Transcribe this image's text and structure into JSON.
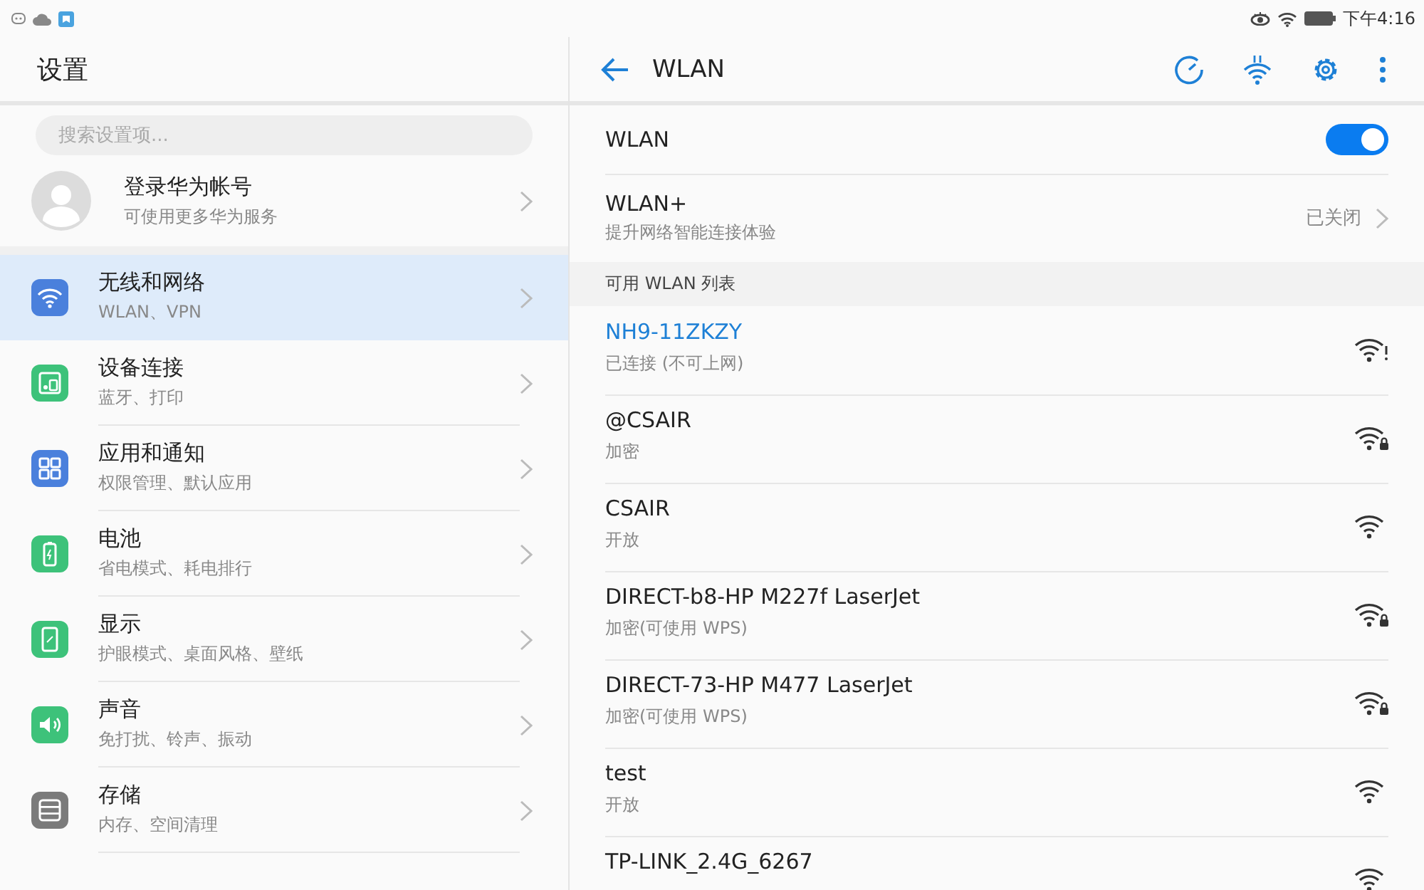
{
  "status_bar": {
    "time": "下午4:16"
  },
  "sidebar": {
    "title": "设置",
    "search": {
      "placeholder": "搜索设置项..."
    },
    "account": {
      "title": "登录华为帐号",
      "subtitle": "可使用更多华为服务"
    },
    "items": [
      {
        "title": "无线和网络",
        "subtitle": "WLAN、VPN",
        "color": "#4a80dc",
        "selected": true
      },
      {
        "title": "设备连接",
        "subtitle": "蓝牙、打印",
        "color": "#3dc27a",
        "selected": false
      },
      {
        "title": "应用和通知",
        "subtitle": "权限管理、默认应用",
        "color": "#4a80dc",
        "selected": false
      },
      {
        "title": "电池",
        "subtitle": "省电模式、耗电排行",
        "color": "#3dc27a",
        "selected": false
      },
      {
        "title": "显示",
        "subtitle": "护眼模式、桌面风格、壁纸",
        "color": "#3dc27a",
        "selected": false
      },
      {
        "title": "声音",
        "subtitle": "免打扰、铃声、振动",
        "color": "#3dc27a",
        "selected": false
      },
      {
        "title": "存储",
        "subtitle": "内存、空间清理",
        "color": "#7b7b7b",
        "selected": false
      }
    ]
  },
  "main": {
    "title": "WLAN",
    "wlan": {
      "label": "WLAN",
      "on": true
    },
    "wlan_plus": {
      "label": "WLAN+",
      "subtitle": "提升网络智能连接体验",
      "value": "已关闭"
    },
    "section": "可用 WLAN 列表",
    "networks": [
      {
        "name": "NH9-11ZKZY",
        "status": "已连接 (不可上网)",
        "connected": true,
        "secured": false,
        "no_internet": true
      },
      {
        "name": "@CSAIR",
        "status": "加密",
        "connected": false,
        "secured": true,
        "no_internet": false
      },
      {
        "name": "CSAIR",
        "status": "开放",
        "connected": false,
        "secured": false,
        "no_internet": false
      },
      {
        "name": "DIRECT-b8-HP M227f LaserJet",
        "status": "加密(可使用 WPS)",
        "connected": false,
        "secured": true,
        "no_internet": false
      },
      {
        "name": "DIRECT-73-HP M477 LaserJet",
        "status": "加密(可使用 WPS)",
        "connected": false,
        "secured": true,
        "no_internet": false
      },
      {
        "name": "test",
        "status": "开放",
        "connected": false,
        "secured": false,
        "no_internet": false
      },
      {
        "name": "TP-LINK_2.4G_6267",
        "connected": false,
        "secured": false,
        "no_internet": false
      }
    ]
  }
}
